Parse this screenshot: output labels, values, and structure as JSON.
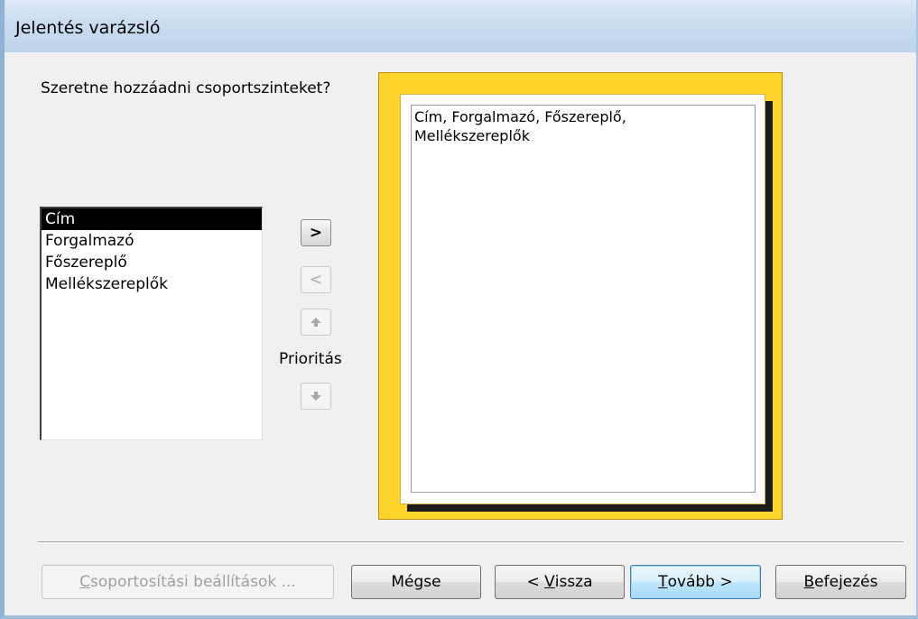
{
  "window": {
    "title": "Jelentés varázsló"
  },
  "question": "Szeretne hozzáadni csoportszinteket?",
  "fields": [
    {
      "label": "Cím",
      "selected": true
    },
    {
      "label": "Forgalmazó",
      "selected": false
    },
    {
      "label": "Főszereplő",
      "selected": false
    },
    {
      "label": "Mellékszereplők",
      "selected": false
    }
  ],
  "move_buttons": {
    "add_label": ">",
    "remove_label": "<",
    "add_enabled": true,
    "remove_enabled": false,
    "priority_up_icon": "up-arrow-icon",
    "priority_down_icon": "down-arrow-icon",
    "priority_up_enabled": false,
    "priority_down_enabled": false
  },
  "priority_label": "Prioritás",
  "preview": {
    "text_line1": "Cím, Forgalmazó, Főszereplő,",
    "text_line2": "Mellékszereplők",
    "frame_color": "#ffd42a"
  },
  "buttons": {
    "grouping_options": {
      "prefix": "",
      "mnemonic": "C",
      "rest": "soportosítási beállítások ...",
      "enabled": false
    },
    "cancel": {
      "label": "Mégse"
    },
    "back": {
      "prefix": "< ",
      "mnemonic": "V",
      "rest": "issza"
    },
    "next": {
      "prefix": "",
      "mnemonic": "T",
      "rest": "ovább >"
    },
    "finish": {
      "prefix": "",
      "mnemonic": "B",
      "rest": "efejezés"
    }
  }
}
